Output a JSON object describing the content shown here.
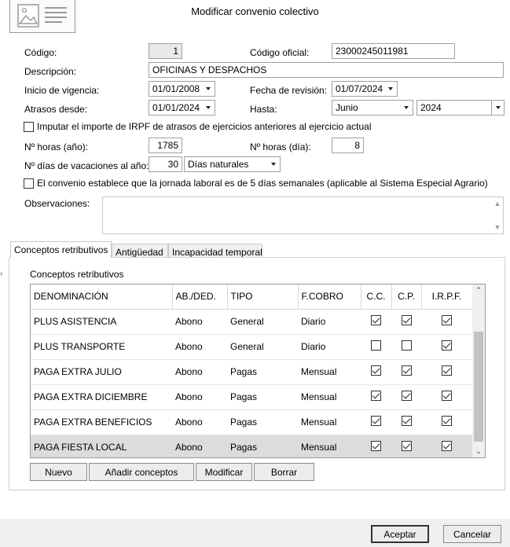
{
  "window": {
    "title": "Modificar convenio colectivo"
  },
  "form": {
    "codigo": {
      "label": "Código:",
      "value": "1"
    },
    "codigo_oficial": {
      "label": "Código oficial:",
      "value": "23000245011981"
    },
    "descripcion": {
      "label": "Descripción:",
      "value": "OFICINAS Y DESPACHOS"
    },
    "inicio_vigencia": {
      "label": "Inicio de vigencia:",
      "value": "01/01/2008"
    },
    "fecha_revision": {
      "label": "Fecha de revisión:",
      "value": "01/07/2024"
    },
    "atrasos_desde": {
      "label": "Atrasos desde:",
      "value": "01/01/2024"
    },
    "hasta": {
      "label": "Hasta:",
      "month": "Junio",
      "year": "2024"
    },
    "imputar_irpf": {
      "label": "Imputar el importe de IRPF de atrasos de ejercicios anteriores al ejercicio actual",
      "checked": false
    },
    "horas_anio": {
      "label": "Nº horas (año):",
      "value": "1785"
    },
    "horas_dia": {
      "label": "Nº horas (día):",
      "value": "8"
    },
    "dias_vacaciones": {
      "label": "Nº días de vacaciones al año:",
      "value": "30",
      "type": "Días naturales"
    },
    "jornada_5_dias": {
      "label": "El convenio establece que la jornada laboral es de 5 días semanales (aplicable al Sistema Especial Agrario)",
      "checked": false
    },
    "observaciones": {
      "label": "Observaciones:",
      "value": ""
    }
  },
  "tabs": [
    {
      "label": "Conceptos retributivos",
      "active": true
    },
    {
      "label": "Antigüedad",
      "active": false
    },
    {
      "label": "Incapacidad temporal",
      "active": false
    }
  ],
  "group_title": "Conceptos retributivos",
  "table": {
    "headers": [
      "DENOMINACIÓN",
      "AB./DED.",
      "TIPO",
      "F.COBRO",
      "C.C.",
      "C.P.",
      "I.R.P.F."
    ],
    "rows": [
      {
        "denominacion": "PLUS ASISTENCIA",
        "abded": "Abono",
        "tipo": "General",
        "fcobro": "Diario",
        "cc": true,
        "cp": true,
        "irpf": true
      },
      {
        "denominacion": "PLUS TRANSPORTE",
        "abded": "Abono",
        "tipo": "General",
        "fcobro": "Diario",
        "cc": false,
        "cp": false,
        "irpf": true
      },
      {
        "denominacion": "PAGA EXTRA JULIO",
        "abded": "Abono",
        "tipo": "Pagas",
        "fcobro": "Mensual",
        "cc": true,
        "cp": true,
        "irpf": true
      },
      {
        "denominacion": "PAGA EXTRA DICIEMBRE",
        "abded": "Abono",
        "tipo": "Pagas",
        "fcobro": "Mensual",
        "cc": true,
        "cp": true,
        "irpf": true
      },
      {
        "denominacion": "PAGA EXTRA BENEFICIOS",
        "abded": "Abono",
        "tipo": "Pagas",
        "fcobro": "Mensual",
        "cc": true,
        "cp": true,
        "irpf": true
      },
      {
        "denominacion": "PAGA FIESTA LOCAL",
        "abded": "Abono",
        "tipo": "Pagas",
        "fcobro": "Mensual",
        "cc": true,
        "cp": true,
        "irpf": true,
        "selected": true
      }
    ]
  },
  "buttons": {
    "nuevo": "Nuevo",
    "anadir": "Añadir conceptos",
    "modificar": "Modificar",
    "borrar": "Borrar",
    "aceptar": "Aceptar",
    "cancelar": "Cancelar"
  },
  "icons": {
    "document": "document-icon",
    "dropdown": "chevron-down-icon",
    "scroll_up": "scroll-up-icon",
    "scroll_down": "scroll-down-icon",
    "side_marker": "chevron-right-icon"
  },
  "colors": {
    "selected_row": "#dcdcdc",
    "footer": "#f0f0f0",
    "field_border": "#a0a0a0"
  }
}
